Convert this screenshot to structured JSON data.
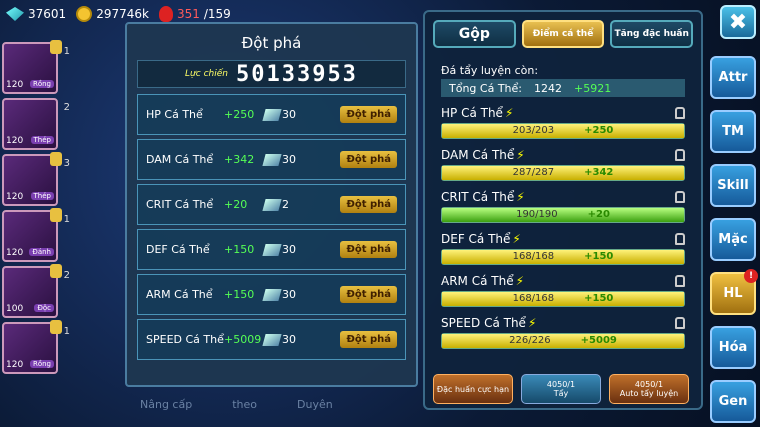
{
  "currencies": {
    "gems": "37601",
    "gold": "297746k",
    "stamina_current": "351",
    "stamina_max": "/159"
  },
  "heroes": [
    {
      "level": "120",
      "tag": "Rồng",
      "index": "1"
    },
    {
      "level": "120",
      "tag": "Thép",
      "index": "2"
    },
    {
      "level": "120",
      "tag": "Thép",
      "index": "3"
    },
    {
      "level": "120",
      "tag": "Đánh",
      "index": "1"
    },
    {
      "level": "100",
      "tag": "Độc",
      "index": "2"
    },
    {
      "level": "120",
      "tag": "Rồng",
      "index": "1"
    }
  ],
  "breakthrough": {
    "title": "Đột phá",
    "power_label": "Lực chiến",
    "power_value": "50133953",
    "rows": [
      {
        "name": "HP Cá Thể",
        "plus": "+250",
        "cost": "30",
        "button": "Đột phá"
      },
      {
        "name": "DAM Cá Thể",
        "plus": "+342",
        "cost": "30",
        "button": "Đột phá"
      },
      {
        "name": "CRIT Cá Thể",
        "plus": "+20",
        "cost": "2",
        "button": "Đột phá"
      },
      {
        "name": "DEF Cá Thể",
        "plus": "+150",
        "cost": "30",
        "button": "Đột phá"
      },
      {
        "name": "ARM Cá Thể",
        "plus": "+150",
        "cost": "30",
        "button": "Đột phá"
      },
      {
        "name": "SPEED Cá Thể",
        "plus": "+5009",
        "cost": "30",
        "button": "Đột phá"
      }
    ]
  },
  "bottom_nav": [
    "Nâng cấp",
    "theo",
    "Duyên"
  ],
  "right": {
    "tabs": [
      "Gộp",
      "Điểm cá thể",
      "Tăng đặc huấn"
    ],
    "remain_label": "Đá tẩy luyện còn:",
    "total_label": "Tổng Cá Thể:",
    "total_value": "1242",
    "total_plus": "+5921",
    "stats": [
      {
        "name": "HP Cá Thể",
        "value": "203/203",
        "plus": "+250",
        "fill": 1.0,
        "color": "yellow"
      },
      {
        "name": "DAM Cá Thể",
        "value": "287/287",
        "plus": "+342",
        "fill": 1.0,
        "color": "yellow"
      },
      {
        "name": "CRIT Cá Thể",
        "value": "190/190",
        "plus": "+20",
        "fill": 1.0,
        "color": "green"
      },
      {
        "name": "DEF Cá Thể",
        "value": "168/168",
        "plus": "+150",
        "fill": 1.0,
        "color": "yellow"
      },
      {
        "name": "ARM Cá Thể",
        "value": "168/168",
        "plus": "+150",
        "fill": 1.0,
        "color": "yellow"
      },
      {
        "name": "SPEED Cá Thể",
        "value": "226/226",
        "plus": "+5009",
        "fill": 1.0,
        "color": "yellow"
      }
    ],
    "buttons": [
      {
        "label": "Đặc huấn cực hạn",
        "count": ""
      },
      {
        "label": "Tẩy",
        "count": "4050/1"
      },
      {
        "label": "Auto tẩy luyện",
        "count": "4050/1"
      }
    ]
  },
  "side_buttons": [
    "Attr",
    "TM",
    "Skill",
    "Mặc",
    "HL",
    "Hóa",
    "Gen"
  ],
  "close_label": "✖",
  "hl_badge": "!"
}
